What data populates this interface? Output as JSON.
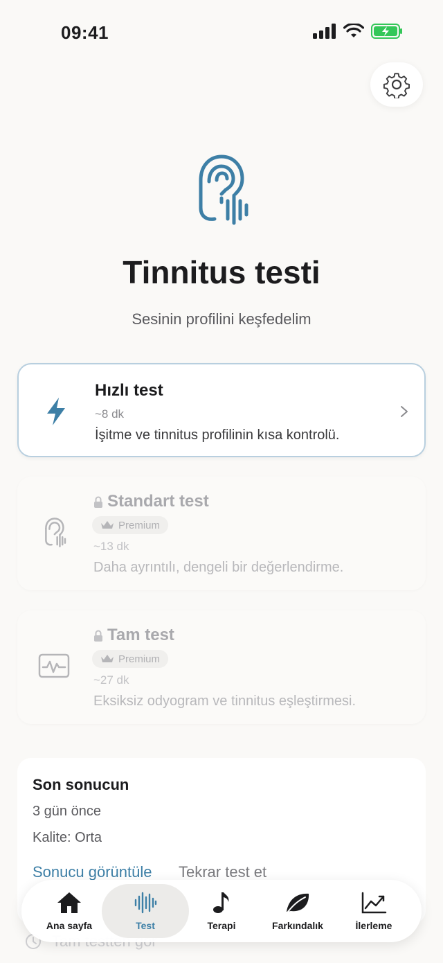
{
  "status_bar": {
    "time": "09:41"
  },
  "header": {
    "title": "Tinnitus testi",
    "subtitle": "Sesinin profilini keşfedelim"
  },
  "tests": {
    "quick": {
      "title": "Hızlı test",
      "duration": "~8 dk",
      "description": "İşitme ve tinnitus profilinin kısa kontrolü."
    },
    "standard": {
      "title": "Standart test",
      "badge": "Premium",
      "duration": "~13 dk",
      "description": "Daha ayrıntılı, dengeli bir değerlendirme."
    },
    "full": {
      "title": "Tam test",
      "badge": "Premium",
      "duration": "~27 dk",
      "description": "Eksiksiz odyogram ve tinnitus eşleştirmesi."
    }
  },
  "last_result": {
    "title": "Son sonucun",
    "when": "3 gün önce",
    "quality": "Kalite: Orta",
    "view_link": "Sonucu görüntüle",
    "retest": "Tekrar test et",
    "full_test_link": "Tam testten gör"
  },
  "tab_bar": {
    "home": "Ana sayfa",
    "test": "Test",
    "therapy": "Terapi",
    "awareness": "Farkındalık",
    "progress": "İlerleme"
  },
  "colors": {
    "accent": "#3d7fa6",
    "background": "#faf9f7",
    "battery": "#34c759"
  }
}
